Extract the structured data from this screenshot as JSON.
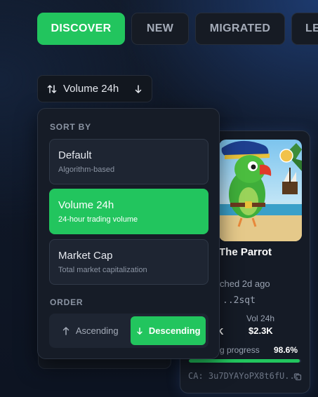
{
  "tabs": [
    {
      "label": "DISCOVER",
      "active": true
    },
    {
      "label": "NEW",
      "active": false
    },
    {
      "label": "MIGRATED",
      "active": false
    },
    {
      "label": "LE",
      "active": false
    }
  ],
  "sort_trigger": {
    "label": "Volume 24h",
    "icon": "sort-arrows-icon",
    "chevron": "arrow-down-icon"
  },
  "dropdown": {
    "sort_by_label": "SORT BY",
    "options": [
      {
        "title": "Default",
        "desc": "Algorithm-based",
        "selected": false
      },
      {
        "title": "Volume 24h",
        "desc": "24-hour trading volume",
        "selected": true
      },
      {
        "title": "Market Cap",
        "desc": "Total market capitalization",
        "selected": false
      }
    ],
    "order_label": "ORDER",
    "order": {
      "ascending": "Ascending",
      "descending": "Descending",
      "selected": "descending"
    }
  },
  "token": {
    "name": "The Parrot",
    "launched": "ched 2d ago",
    "ca_short": "..2sqt",
    "stat_a_value": "K",
    "vol_label": "Vol 24h",
    "vol_value": "$2.3K",
    "progress_label": "g progress",
    "progress_pct": "98.6%",
    "progress_value": 0.986,
    "ca_full": "CA: 3u7DYAYoPX8t6fU..."
  },
  "colors": {
    "accent": "#22c55e",
    "panel": "#161c27",
    "background": "#0f1726"
  }
}
